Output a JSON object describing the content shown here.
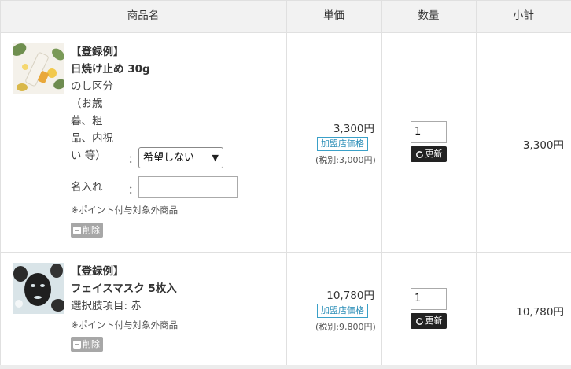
{
  "header": {
    "product_name": "商品名",
    "unit_price": "単価",
    "quantity": "数量",
    "subtotal": "小計"
  },
  "items": [
    {
      "image_icon": "sunscreen-tube-photo",
      "tag": "【登録例】",
      "name": "日焼け止め 30g",
      "option_label_lines": [
        "のし区分",
        "（お歳",
        "暮、粗",
        "品、内祝",
        "い 等）"
      ],
      "option_colon": "：",
      "option_value": "希望しない",
      "engrave_label": "名入れ",
      "engrave_colon": "：",
      "engrave_value": "",
      "note": "※ポイント付与対象外商品",
      "delete_label": "削除",
      "price": "3,300円",
      "price_badge": "加盟店価格",
      "tax_excluded": "(税別:3,000円)",
      "quantity": "1",
      "update_label": "更新",
      "subtotal": "3,300円"
    },
    {
      "image_icon": "face-mask-photo",
      "tag": "【登録例】",
      "name": "フェイスマスク 5枚入",
      "option_text": "選択肢項目: 赤",
      "note": "※ポイント付与対象外商品",
      "delete_label": "削除",
      "price": "10,780円",
      "price_badge": "加盟店価格",
      "tax_excluded": "(税別:9,800円)",
      "quantity": "1",
      "update_label": "更新",
      "subtotal": "10,780円"
    }
  ],
  "colors": {
    "header_bg": "#f2f2f2",
    "border": "#e0e0e0",
    "badge": "#3aa0c8",
    "update_bg": "#222222",
    "delete_bg": "#a7a7a7"
  }
}
